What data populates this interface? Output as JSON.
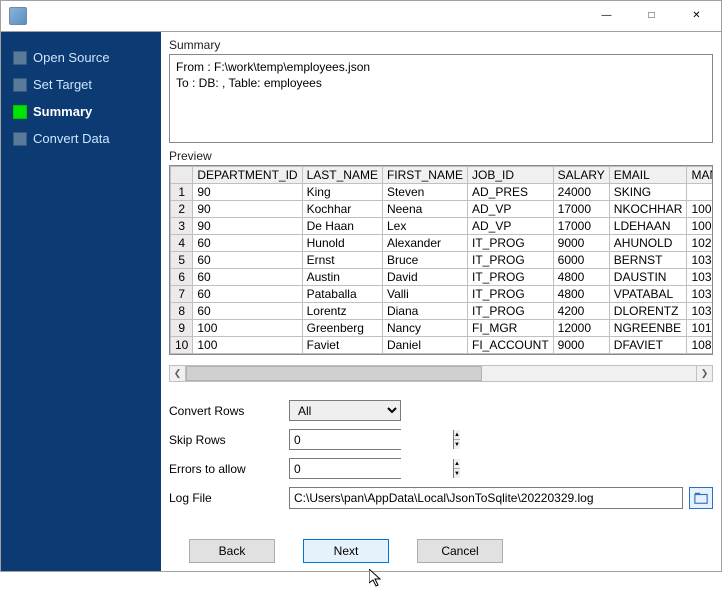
{
  "sidebar": {
    "items": [
      {
        "label": "Open Source",
        "active": false
      },
      {
        "label": "Set Target",
        "active": false
      },
      {
        "label": "Summary",
        "active": true
      },
      {
        "label": "Convert Data",
        "active": false
      }
    ]
  },
  "summary": {
    "title": "Summary",
    "text": "From : F:\\work\\temp\\employees.json\nTo : DB:                          , Table: employees"
  },
  "preview": {
    "title": "Preview",
    "columns": [
      "DEPARTMENT_ID",
      "LAST_NAME",
      "FIRST_NAME",
      "JOB_ID",
      "SALARY",
      "EMAIL",
      "MANAG"
    ],
    "rows": [
      [
        "90",
        "King",
        "Steven",
        "AD_PRES",
        "24000",
        "SKING",
        ""
      ],
      [
        "90",
        "Kochhar",
        "Neena",
        "AD_VP",
        "17000",
        "NKOCHHAR",
        "100"
      ],
      [
        "90",
        "De Haan",
        "Lex",
        "AD_VP",
        "17000",
        "LDEHAAN",
        "100"
      ],
      [
        "60",
        "Hunold",
        "Alexander",
        "IT_PROG",
        "9000",
        "AHUNOLD",
        "102"
      ],
      [
        "60",
        "Ernst",
        "Bruce",
        "IT_PROG",
        "6000",
        "BERNST",
        "103"
      ],
      [
        "60",
        "Austin",
        "David",
        "IT_PROG",
        "4800",
        "DAUSTIN",
        "103"
      ],
      [
        "60",
        "Pataballa",
        "Valli",
        "IT_PROG",
        "4800",
        "VPATABAL",
        "103"
      ],
      [
        "60",
        "Lorentz",
        "Diana",
        "IT_PROG",
        "4200",
        "DLORENTZ",
        "103"
      ],
      [
        "100",
        "Greenberg",
        "Nancy",
        "FI_MGR",
        "12000",
        "NGREENBE",
        "101"
      ],
      [
        "100",
        "Faviet",
        "Daniel",
        "FI_ACCOUNT",
        "9000",
        "DFAVIET",
        "108"
      ]
    ]
  },
  "form": {
    "convertRows": {
      "label": "Convert Rows",
      "value": "All"
    },
    "skipRows": {
      "label": "Skip Rows",
      "value": "0"
    },
    "errors": {
      "label": "Errors to allow",
      "value": "0"
    },
    "logFile": {
      "label": "Log File",
      "value": "C:\\Users\\pan\\AppData\\Local\\JsonToSqlite\\20220329.log"
    }
  },
  "buttons": {
    "back": "Back",
    "next": "Next",
    "cancel": "Cancel"
  }
}
